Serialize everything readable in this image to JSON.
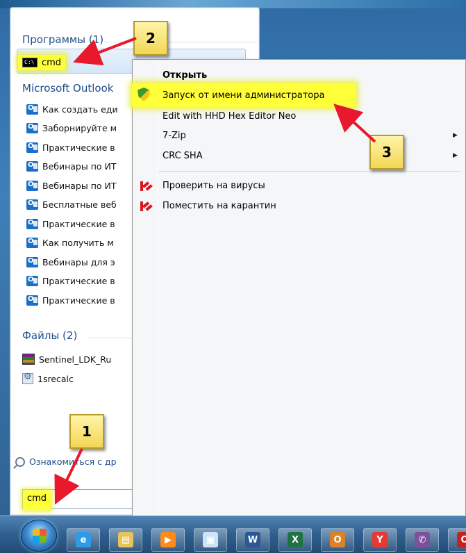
{
  "start_menu": {
    "programs_header": "Программы (1)",
    "program_item": "cmd",
    "outlook_header": "Microsoft Outlook",
    "outlook_items": [
      "Как создать еди",
      "Заборнируйте м",
      "Практические в",
      "Вебинары по ИТ",
      "Вебинары по ИТ",
      "Бесплатные веб",
      "Практические в",
      "Как получить м",
      "Вебинары для э",
      "Практические в",
      "Практические в"
    ],
    "files_header": "Файлы (2)",
    "files": [
      "Sentinel_LDK_Ru",
      "1srecalc"
    ],
    "see_more": "Ознакомиться с др",
    "search_value": "cmd"
  },
  "context_menu": {
    "open": "Открыть",
    "run_as_admin": "Запуск от имени администратора",
    "hex_editor": "Edit with HHD Hex Editor Neo",
    "zip": "7-Zip",
    "crc": "CRC SHA",
    "virus_check": "Проверить на вирусы",
    "quarantine": "Поместить на карантин",
    "submenu_arrow": "▶"
  },
  "callouts": {
    "one": "1",
    "two": "2",
    "three": "3"
  },
  "taskbar": {
    "buttons": [
      {
        "glyph": "e",
        "color": "#2f9be8"
      },
      {
        "glyph": "▤",
        "color": "#e7c35a"
      },
      {
        "glyph": "▶",
        "color": "#ff8c1a"
      },
      {
        "glyph": "▣",
        "color": "#d0e3f5"
      },
      {
        "glyph": "W",
        "color": "#2b5797"
      },
      {
        "glyph": "X",
        "color": "#1f7244"
      },
      {
        "glyph": "O",
        "color": "#d9822b"
      },
      {
        "glyph": "Y",
        "color": "#e53935"
      },
      {
        "glyph": "✆",
        "color": "#7b519d"
      },
      {
        "glyph": "O",
        "color": "#cc1f1f"
      }
    ]
  },
  "colors": {
    "highlight": "#ffff3a",
    "arrow": "#e8192c",
    "callout_fill": "#f3d655"
  }
}
